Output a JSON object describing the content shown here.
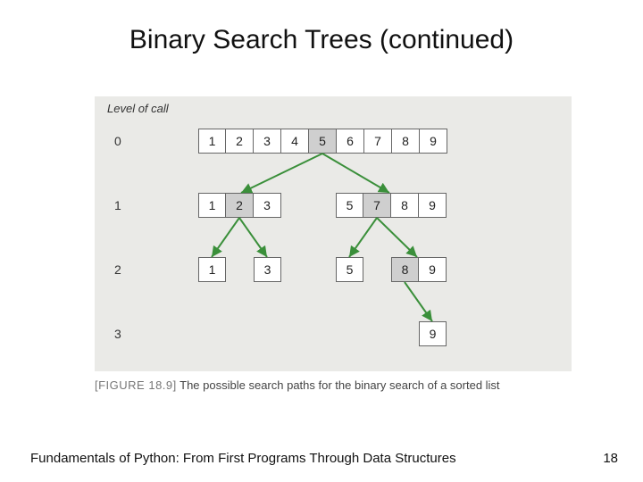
{
  "title": "Binary Search Trees (continued)",
  "figure": {
    "level_label": "Level of call",
    "rows": [
      {
        "label": "0",
        "groups": [
          {
            "cells": [
              "1",
              "2",
              "3",
              "4",
              "5",
              "6",
              "7",
              "8",
              "9"
            ],
            "mid_index": 4
          }
        ]
      },
      {
        "label": "1",
        "groups": [
          {
            "cells": [
              "1",
              "2",
              "3"
            ],
            "mid_index": 1
          },
          {
            "cells": [
              "5",
              "7",
              "8",
              "9"
            ],
            "mid_index": 1
          }
        ]
      },
      {
        "label": "2",
        "groups": [
          {
            "cells": [
              "1"
            ],
            "mid_index": null
          },
          {
            "cells": [
              "3"
            ],
            "mid_index": null
          },
          {
            "cells": [
              "5"
            ],
            "mid_index": null
          },
          {
            "cells": [
              "8",
              "9"
            ],
            "mid_index": 0
          }
        ]
      },
      {
        "label": "3",
        "groups": [
          {
            "cells": [
              "9"
            ],
            "mid_index": null
          }
        ]
      }
    ]
  },
  "caption": {
    "label": "[FIGURE 18.9]",
    "text": "The possible search paths for the binary search of a sorted list"
  },
  "footer": "Fundamentals of Python: From First Programs Through Data Structures",
  "page": "18"
}
